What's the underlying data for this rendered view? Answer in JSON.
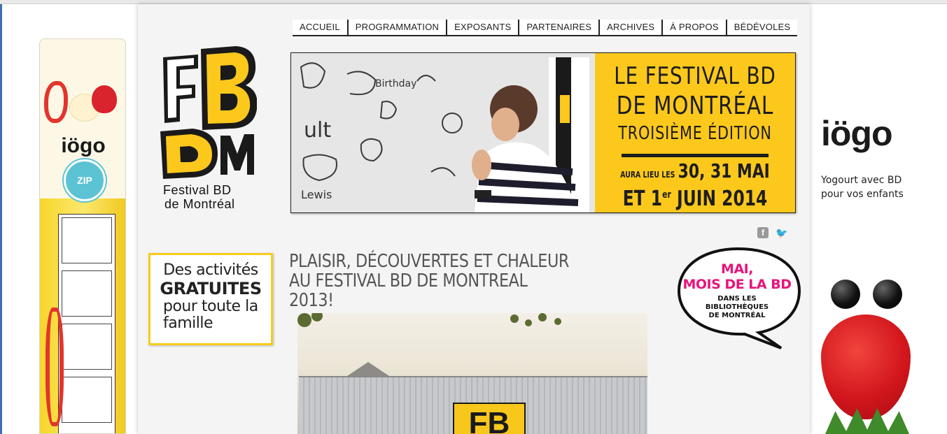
{
  "nav": {
    "items": [
      "ACCUEIL",
      "PROGRAMMATION",
      "EXPOSANTS",
      "PARTENAIRES",
      "ARCHIVES",
      "À PROPOS",
      "BÉDÉVOLES"
    ]
  },
  "logo": {
    "mark": "FBDM",
    "line1": "Festival BD",
    "line2": "de Montréal"
  },
  "banner": {
    "line1": "LE FESTIVAL BD",
    "line2": "DE MONTRÉAL",
    "line3": "TROISIÈME ÉDITION",
    "line4_prefix": "AURA LIEU LES",
    "line4_dates": "30, 31 MAI",
    "line5": "ET 1",
    "line5_sup": "er",
    "line5_end": "JUIN 2014"
  },
  "social": {
    "facebook": "f",
    "twitter": "🐦"
  },
  "promo": {
    "line1": "Des activités",
    "line2": "GRATUITES",
    "line3": "pour toute la",
    "line4": "famille"
  },
  "article": {
    "headline": "PLAISIR, DÉCOUVERTES ET CHALEUR AU FESTIVAL BD DE MONTREAL 2013!",
    "photo_sign": "FB"
  },
  "bubble": {
    "title1": "MAI,",
    "title2": "MOIS DE LA BD",
    "sub1": "DANS LES",
    "sub2": "BIBLIOTHÈQUES",
    "sub3": "DE MONTRÉAL"
  },
  "ad_left": {
    "brand": "iögo",
    "badge": "ZIP"
  },
  "ad_right": {
    "brand": "iögo",
    "tagline": "Yogourt avec BD pour vos enfants"
  },
  "colors": {
    "accent_yellow": "#fcc81c",
    "bubble_pink": "#e8137a",
    "text_dark": "#222222"
  }
}
